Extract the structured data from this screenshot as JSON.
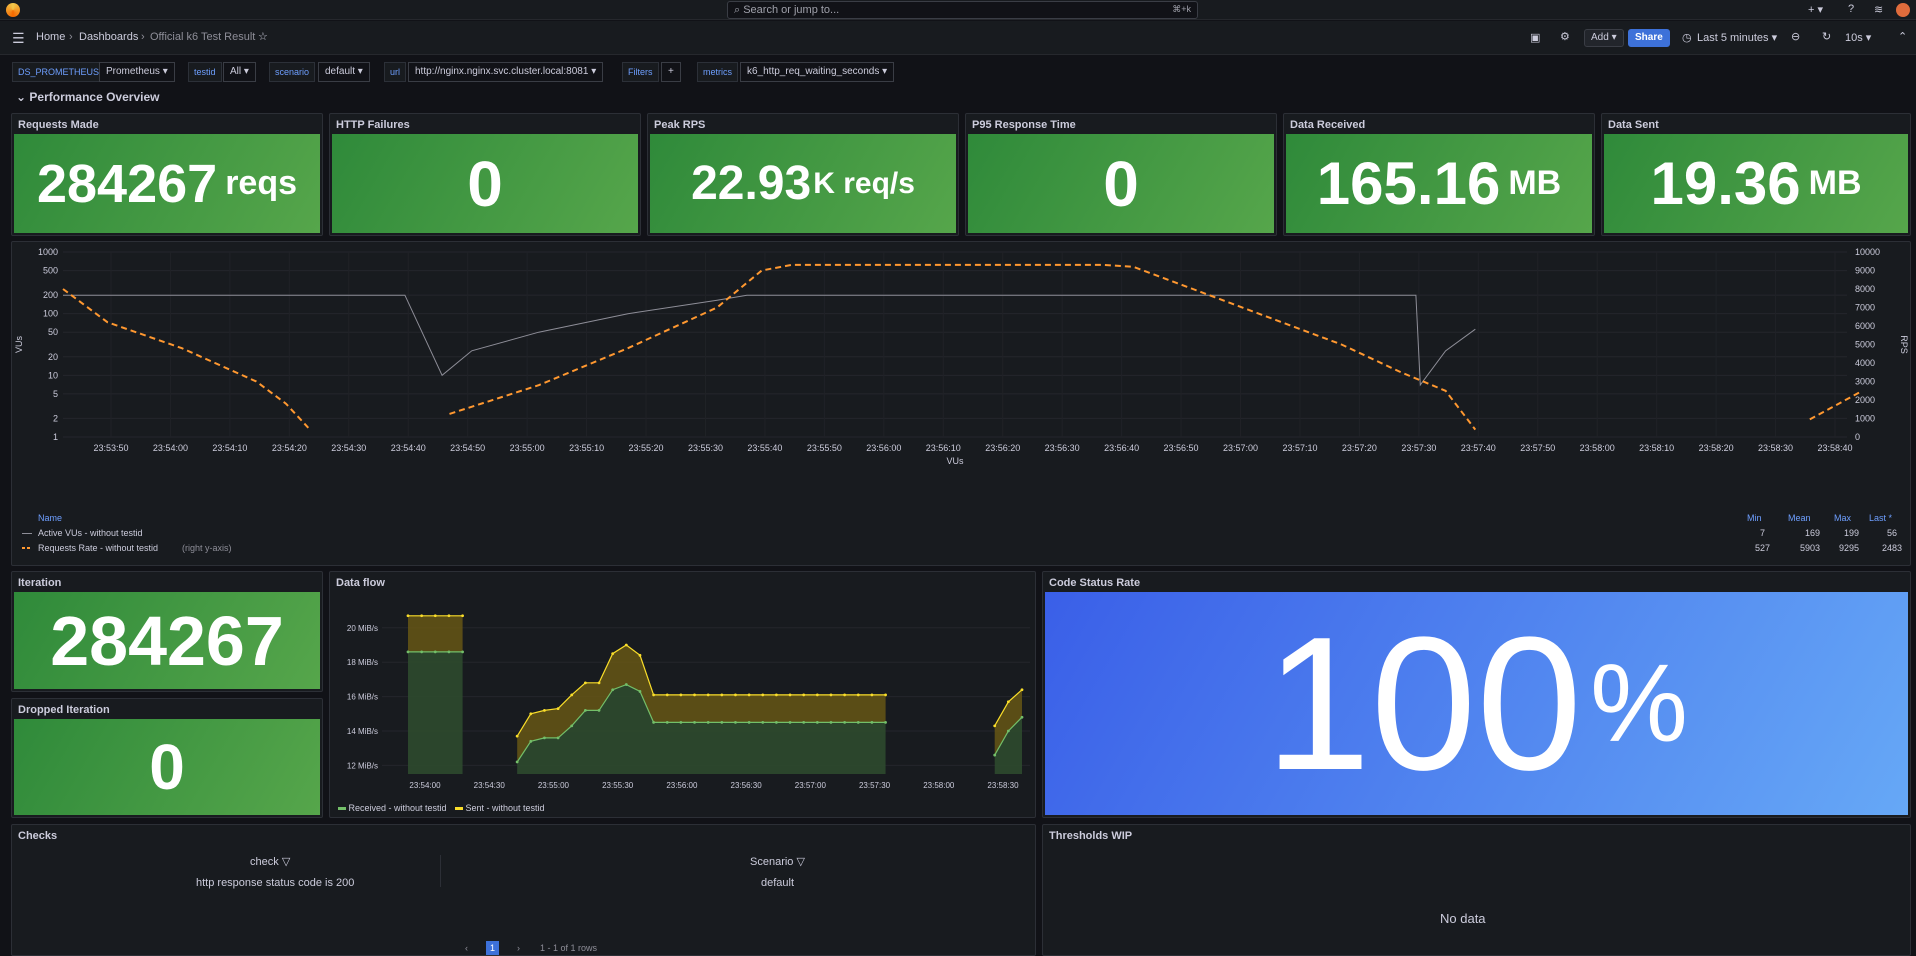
{
  "search": {
    "placeholder": "Search or jump to...",
    "shortcut": "⌘+k"
  },
  "breadcrumb": {
    "home": "Home",
    "dashboards": "Dashboards",
    "current": "Official k6 Test Result"
  },
  "toolbar": {
    "add": "Add",
    "share": "Share",
    "time_range": "Last 5 minutes",
    "refresh": "10s"
  },
  "variables": [
    {
      "label": "DS_PROMETHEUS",
      "value": "Prometheus"
    },
    {
      "label": "testid",
      "value": "All"
    },
    {
      "label": "scenario",
      "value": "default"
    },
    {
      "label": "url",
      "value": "http://nginx.nginx.svc.cluster.local:8081"
    },
    {
      "label": "Filters",
      "value": "+"
    },
    {
      "label": "metrics",
      "value": "k6_http_req_waiting_seconds"
    }
  ],
  "row_title": "Performance Overview",
  "stats": [
    {
      "title": "Requests Made",
      "value": "284267",
      "unit": "reqs"
    },
    {
      "title": "HTTP Failures",
      "value": "0",
      "unit": ""
    },
    {
      "title": "Peak RPS",
      "value": "22.93",
      "unit": "K req/s"
    },
    {
      "title": "P95 Response Time",
      "value": "0",
      "unit": ""
    },
    {
      "title": "Data Received",
      "value": "165.16",
      "unit": "MB"
    },
    {
      "title": "Data Sent",
      "value": "19.36",
      "unit": "MB"
    }
  ],
  "colors": {
    "vus": "#8e8e98",
    "rps": "#ff9830",
    "received": "#73bf69",
    "sent": "#fade2a",
    "stat_green": "#56a64b",
    "stat_blue": "#3d71d9"
  },
  "chart_data": [
    {
      "type": "line",
      "ylabel": "VUs",
      "y2label": "RPS",
      "xlabel": "VUs",
      "y_scale": "log",
      "y_ticks": [
        "1000",
        "500",
        "200",
        "100",
        "50",
        "20",
        "10",
        "5",
        "2",
        "1"
      ],
      "y2_ticks": [
        "10000",
        "9000",
        "8000",
        "7000",
        "6000",
        "5000",
        "4000",
        "3000",
        "2000",
        "1000",
        "0"
      ],
      "x_ticks": [
        "23:53:50",
        "23:54:00",
        "23:54:10",
        "23:54:20",
        "23:54:30",
        "23:54:40",
        "23:54:50",
        "23:55:00",
        "23:55:10",
        "23:55:20",
        "23:55:30",
        "23:55:40",
        "23:55:50",
        "23:56:00",
        "23:56:10",
        "23:56:20",
        "23:56:30",
        "23:56:40",
        "23:56:50",
        "23:57:00",
        "23:57:10",
        "23:57:20",
        "23:57:30",
        "23:57:40",
        "23:57:50",
        "23:58:00",
        "23:58:10",
        "23:58:20",
        "23:58:30",
        "23:58:40"
      ],
      "legend_headers": [
        "Name",
        "Min",
        "Mean",
        "Max",
        "Last *"
      ],
      "series": [
        {
          "name": "Active VUs - without testid",
          "axis": "left",
          "min": "7",
          "mean": "169",
          "max": "199",
          "last": "56",
          "points": [
            [
              0,
              199
            ],
            [
              23,
              199
            ],
            [
              25.5,
              10
            ],
            [
              27.5,
              25
            ],
            [
              32,
              50
            ],
            [
              38,
              100
            ],
            [
              44,
              165
            ],
            [
              46,
              199
            ],
            [
              72,
              199
            ],
            [
              88,
              199
            ],
            [
              91,
              199
            ],
            [
              91.3,
              7
            ],
            [
              93,
              25
            ],
            [
              95,
              56
            ]
          ]
        },
        {
          "name": "Requests Rate - without testid",
          "note": "(right y-axis)",
          "axis": "right",
          "min": "527",
          "mean": "5903",
          "max": "9295",
          "last": "2483",
          "points": [
            [
              0,
              8000
            ],
            [
              3,
              6200
            ],
            [
              8,
              4800
            ],
            [
              13,
              3000
            ],
            [
              15,
              1800
            ],
            [
              16.5,
              500
            ],
            [
              null,
              null
            ],
            [
              26,
              1250
            ],
            [
              32,
              2800
            ],
            [
              38,
              4800
            ],
            [
              44,
              7000
            ],
            [
              47,
              9000
            ],
            [
              49,
              9300
            ],
            [
              70,
              9300
            ],
            [
              72,
              9200
            ],
            [
              76,
              8000
            ],
            [
              81,
              6500
            ],
            [
              86,
              5000
            ],
            [
              90,
              3500
            ],
            [
              93,
              2500
            ],
            [
              95,
              400
            ],
            [
              null,
              null
            ],
            [
              117.5,
              950
            ],
            [
              121,
              2483
            ]
          ]
        }
      ]
    },
    {
      "type": "area",
      "y_ticks": [
        "20 MiB/s",
        "18 MiB/s",
        "16 MiB/s",
        "14 MiB/s",
        "12 MiB/s"
      ],
      "x_ticks": [
        "23:54:00",
        "23:54:30",
        "23:55:00",
        "23:55:30",
        "23:56:00",
        "23:56:30",
        "23:57:00",
        "23:57:30",
        "23:58:00",
        "23:58:30"
      ],
      "series": [
        {
          "name": "Received - without testid",
          "values": [
            18.6,
            18.6,
            18.6,
            18.6,
            18.6,
            null,
            null,
            null,
            12.2,
            13.4,
            13.6,
            13.6,
            14.3,
            15.2,
            15.2,
            16.4,
            16.7,
            16.3,
            14.5,
            14.5,
            14.5,
            14.5,
            14.5,
            14.5,
            14.5,
            14.5,
            14.5,
            14.5,
            14.5,
            14.5,
            14.5,
            14.5,
            14.5,
            14.5,
            14.5,
            14.5,
            null,
            null,
            null,
            null,
            null,
            null,
            null,
            12.6,
            14.0,
            14.8
          ]
        },
        {
          "name": "Sent - without testid",
          "values": [
            20.7,
            20.7,
            20.7,
            20.7,
            20.7,
            null,
            null,
            null,
            13.7,
            15.0,
            15.2,
            15.3,
            16.1,
            16.8,
            16.8,
            18.5,
            19.0,
            18.4,
            16.1,
            16.1,
            16.1,
            16.1,
            16.1,
            16.1,
            16.1,
            16.1,
            16.1,
            16.1,
            16.1,
            16.1,
            16.1,
            16.1,
            16.1,
            16.1,
            16.1,
            16.1,
            null,
            null,
            null,
            null,
            null,
            null,
            null,
            14.3,
            15.7,
            16.4
          ]
        }
      ]
    }
  ],
  "iteration": {
    "title": "Iteration",
    "value": "284267"
  },
  "dropped": {
    "title": "Dropped Iteration",
    "value": "0"
  },
  "dataflow": {
    "title": "Data flow"
  },
  "code_status": {
    "title": "Code Status Rate",
    "value": "100",
    "unit": "%"
  },
  "checks": {
    "title": "Checks",
    "columns": [
      "check",
      "Scenario"
    ],
    "rows": [
      [
        "http response status code is 200",
        "default"
      ]
    ],
    "pager": "1",
    "rows_text": "1 - 1 of 1 rows"
  },
  "thresholds": {
    "title": "Thresholds WIP",
    "empty": "No data"
  }
}
